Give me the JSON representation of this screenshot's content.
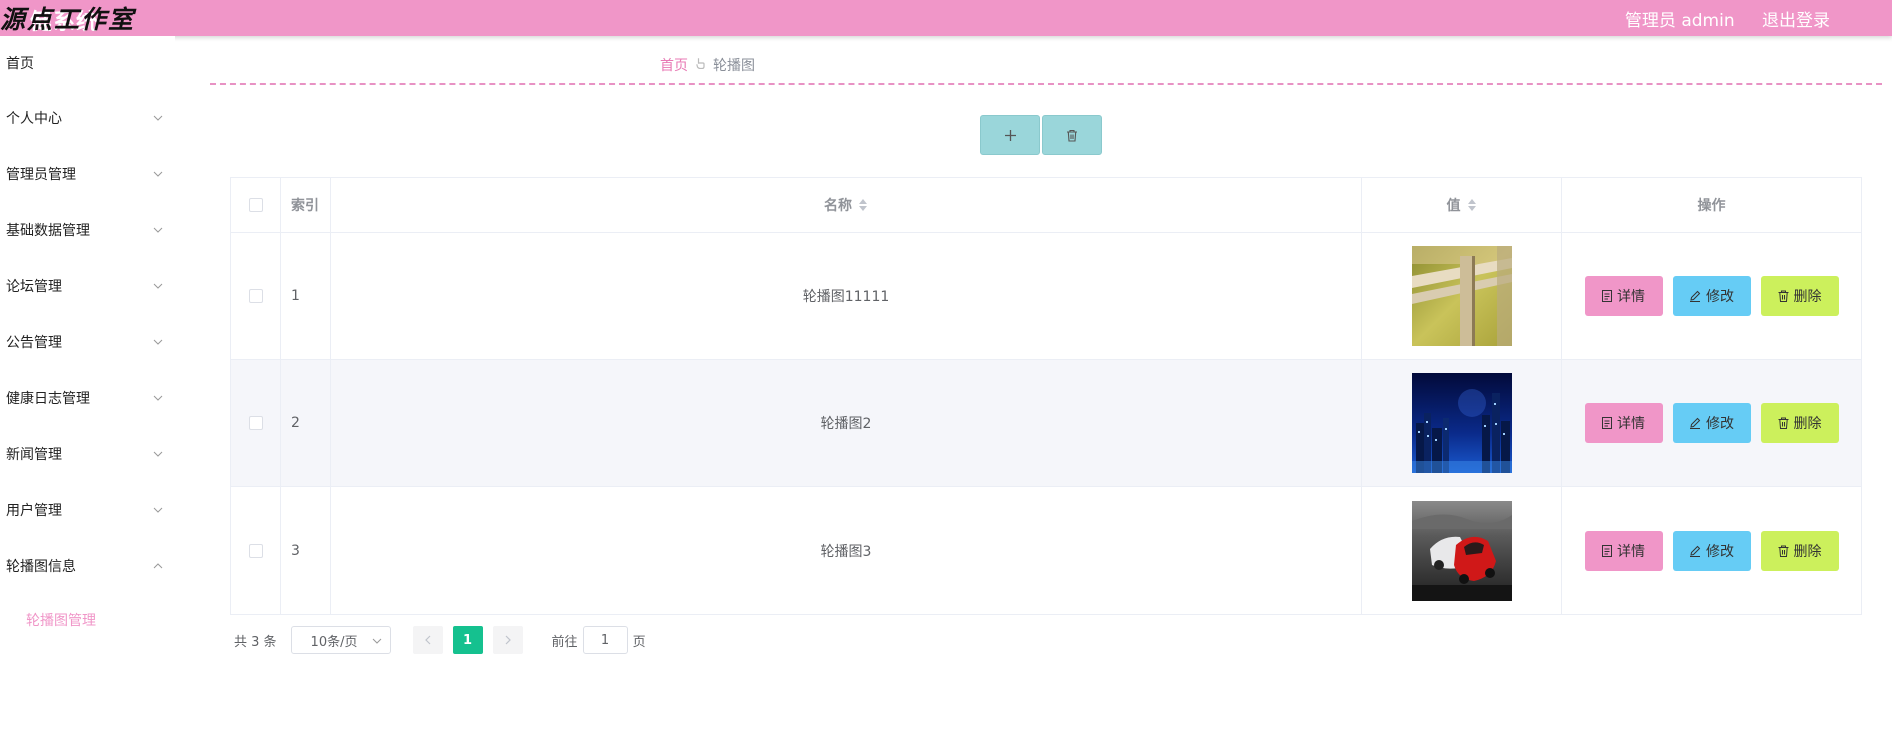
{
  "header": {
    "brand_overlay": "源点工作室",
    "brand_title_fragment": "健系统",
    "user": "管理员 admin",
    "logout": "退出登录",
    "bg_color": "#f096c8"
  },
  "sidebar": {
    "items": [
      {
        "label": "首页",
        "expandable": false
      },
      {
        "label": "个人中心",
        "expandable": true,
        "icon": "chevron-down-icon"
      },
      {
        "label": "管理员管理",
        "expandable": true,
        "icon": "chevron-down-icon"
      },
      {
        "label": "基础数据管理",
        "expandable": true,
        "icon": "chevron-down-icon"
      },
      {
        "label": "论坛管理",
        "expandable": true,
        "icon": "chevron-down-icon"
      },
      {
        "label": "公告管理",
        "expandable": true,
        "icon": "chevron-down-icon"
      },
      {
        "label": "健康日志管理",
        "expandable": true,
        "icon": "chevron-down-icon"
      },
      {
        "label": "新闻管理",
        "expandable": true,
        "icon": "chevron-down-icon"
      },
      {
        "label": "用户管理",
        "expandable": true,
        "icon": "chevron-down-icon"
      },
      {
        "label": "轮播图信息",
        "expandable": true,
        "expanded": true,
        "icon": "chevron-up-icon"
      }
    ],
    "submenu": [
      {
        "label": "轮播图管理",
        "active": true
      }
    ]
  },
  "breadcrumb": {
    "home": "首页",
    "current": "轮播图"
  },
  "toolbar": {
    "add_icon": "plus-icon",
    "delete_icon": "trash-icon",
    "color": "#9ad6da"
  },
  "table": {
    "columns": {
      "index": "索引",
      "name": "名称",
      "value": "值",
      "actions": "操作"
    },
    "rows": [
      {
        "index": "1",
        "name": "轮播图11111",
        "image": "fence-photo"
      },
      {
        "index": "2",
        "name": "轮播图2",
        "image": "city-night-photo"
      },
      {
        "index": "3",
        "name": "轮播图3",
        "image": "sports-cars-photo"
      }
    ],
    "actions": {
      "detail": "详情",
      "edit": "修改",
      "delete": "删除"
    }
  },
  "pagination": {
    "total": "共 3 条",
    "page_size": "10条/页",
    "current_page": "1",
    "goto_prefix": "前往",
    "goto_value": "1",
    "goto_suffix": "页",
    "active_color": "#15c18f"
  }
}
